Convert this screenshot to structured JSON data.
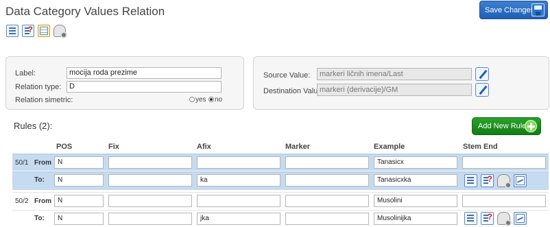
{
  "header": {
    "title": "Data Category Values Relation",
    "save_label": "Save Changes"
  },
  "toolbar": {
    "icons": [
      "list-icon",
      "list-question-icon",
      "grid-icon",
      "database-gear-icon"
    ]
  },
  "relation": {
    "label_caption": "Label:",
    "label_value": "mocija roda prezime",
    "type_caption": "Relation type:",
    "type_value": "D",
    "simetric_caption": "Relation simetric:",
    "yes_label": "yes",
    "no_label": "no",
    "simetric_selected": "no"
  },
  "values": {
    "source_caption": "Source Value:",
    "source_value": "markeri ličnih imena/Last",
    "destination_caption": "Destination Value:",
    "destination_value": "markeri (derivacije)/GM"
  },
  "rules": {
    "title": "Rules (2):",
    "add_label": "Add New Rule",
    "columns": [
      "POS",
      "Fix",
      "Afix",
      "Marker",
      "Example",
      "Stem End"
    ],
    "rows": [
      {
        "id": "50/1",
        "dir": "From",
        "pos": "N",
        "fix": "",
        "afix": "",
        "marker": "",
        "example": "Tanasicx",
        "stem_end": ""
      },
      {
        "id": "",
        "dir": "To:",
        "pos": "N",
        "fix": "",
        "afix": "ka",
        "marker": "",
        "example": "Tanasicxka",
        "stem_end": ""
      },
      {
        "id": "50/2",
        "dir": "From",
        "pos": "N",
        "fix": "",
        "afix": "",
        "marker": "",
        "example": "Musolini",
        "stem_end": ""
      },
      {
        "id": "",
        "dir": "To:",
        "pos": "N",
        "fix": "",
        "afix": "jka",
        "marker": "",
        "example": "Musolinijka",
        "stem_end": ""
      }
    ]
  },
  "colors": {
    "accent_blue": "#1f5fb5",
    "add_green": "#1a8c1a",
    "selected_row": "#c5dbf0"
  }
}
